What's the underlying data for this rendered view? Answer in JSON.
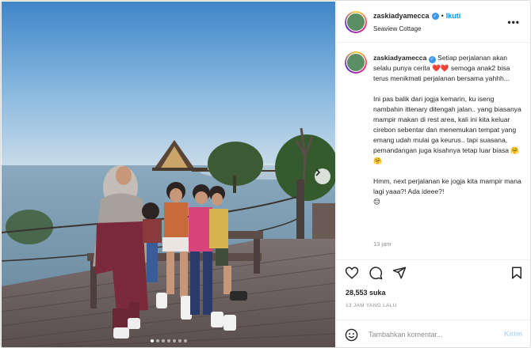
{
  "post": {
    "username": "zaskiadyamecca",
    "follow_label": "Ikuti",
    "separator": "•",
    "location": "Seaview Cottage",
    "more_label": "•••"
  },
  "caption": {
    "username": "zaskiadyamecca",
    "text": "Setiap perjalanan akan selalu punya cerita ❤️❤️ semoga anak2 bisa terus menikmati perjalanan bersama yahhh...\n\nIni pas balik dari jogja kemarin, ku iseng nambahin ittenary ditengah jalan.. yang biasanya mampir makan di rest area, kali ini kita keluar cirebon sebentar dan menemukan tempat yang emang udah mulai ga keurus.. tapi suasana, pemandangan juga kisahnya tetap luar biasa 🤗🤗\n\nHmm, next perjalanan ke jogja kita mampir mana lagi yaaa?! Ada ideee?!\n😌",
    "time_ago": "13 jam"
  },
  "engagement": {
    "likes": "28,553 suka",
    "posted": "13 JAM YANG LALU"
  },
  "comment": {
    "placeholder": "Tambahkan komentar...",
    "send_label": "Kirim"
  },
  "carousel": {
    "slide_count": 7,
    "active_index": 0
  },
  "icons": {
    "like": "heart-icon",
    "comment": "comment-icon",
    "share": "send-icon",
    "save": "bookmark-icon",
    "emoji": "smiley-icon",
    "next": "chevron-right-icon"
  },
  "colors": {
    "accent": "#0095f6",
    "verified": "#3897f0",
    "send_disabled": "#b3dbff"
  }
}
